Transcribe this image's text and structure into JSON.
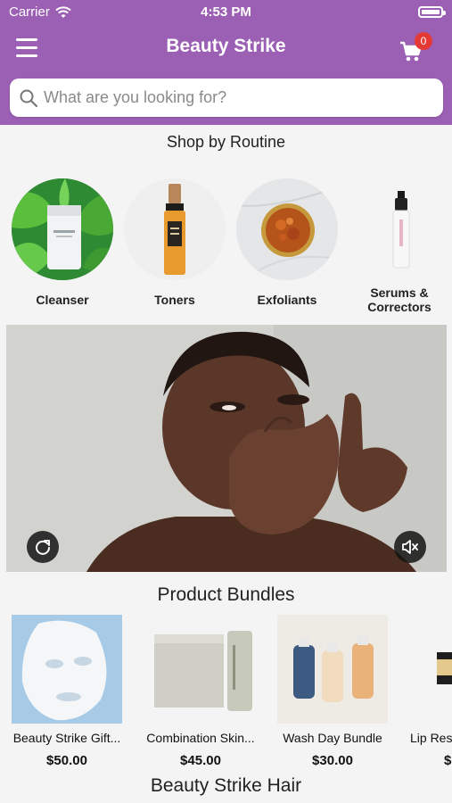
{
  "status_bar": {
    "carrier": "Carrier",
    "time": "4:53 PM"
  },
  "header": {
    "title": "Beauty Strike",
    "cart_count": "0"
  },
  "search": {
    "placeholder": "What are you looking for?"
  },
  "routine": {
    "title": "Shop by Routine",
    "items": [
      {
        "label": "Cleanser"
      },
      {
        "label": "Toners"
      },
      {
        "label": "Exfoliants"
      },
      {
        "label": "Serums &\nCorrectors"
      }
    ]
  },
  "video": {
    "replay_icon": "replay-icon",
    "mute_icon": "mute-icon"
  },
  "bundles": {
    "title": "Product Bundles",
    "items": [
      {
        "name": "Beauty Strike Gift...",
        "price": "$50.00"
      },
      {
        "name": "Combination Skin...",
        "price": "$45.00"
      },
      {
        "name": "Wash Day Bundle",
        "price": "$30.00"
      },
      {
        "name": "Lip Res",
        "price": "$"
      }
    ]
  },
  "hair": {
    "title": "Beauty Strike Hair"
  },
  "colors": {
    "header": "#9b5fb4",
    "badge": "#e53935",
    "background": "#f4f4f4"
  }
}
